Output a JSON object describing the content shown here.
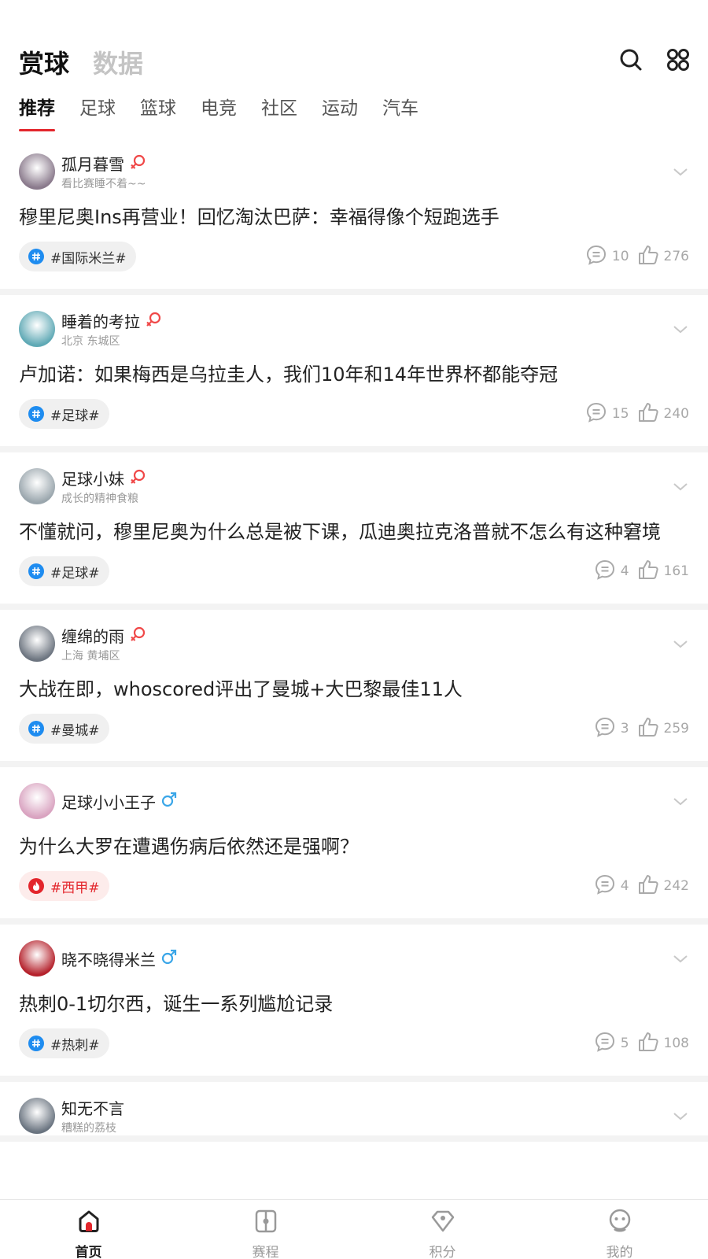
{
  "header": {
    "tab_active": "赏球",
    "tab_inactive": "数据",
    "icons": [
      "search-icon",
      "grid-menu-icon"
    ]
  },
  "sub_tabs": [
    "推荐",
    "足球",
    "篮球",
    "电竞",
    "社区",
    "运动",
    "汽车"
  ],
  "posts": [
    {
      "username": "孤月暮雪",
      "gender": "female",
      "subtitle": "看比赛睡不着~~",
      "title": "穆里尼奥Ins再营业！回忆淘汰巴萨：幸福得像个短跑选手",
      "tag": "#国际米兰#",
      "tag_kind": "topic",
      "comments": "10",
      "likes": "276",
      "avatar_color": "#8a7a8c"
    },
    {
      "username": "睡着的考拉",
      "gender": "female",
      "subtitle": "北京 东城区",
      "title": "卢加诺：如果梅西是乌拉圭人，我们10年和14年世界杯都能夺冠",
      "tag": "#足球#",
      "tag_kind": "topic",
      "comments": "15",
      "likes": "240",
      "avatar_color": "#5fa9b5"
    },
    {
      "username": "足球小妹",
      "gender": "female",
      "subtitle": "成长的精神食粮",
      "title": "不懂就问，穆里尼奥为什么总是被下课，瓜迪奥拉克洛普就不怎么有这种窘境",
      "tag": "#足球#",
      "tag_kind": "topic",
      "comments": "4",
      "likes": "161",
      "avatar_color": "#9aa6ad"
    },
    {
      "username": "缠绵的雨",
      "gender": "female",
      "subtitle": "上海 黄埔区",
      "title": "大战在即，whoscored评出了曼城+大巴黎最佳11人",
      "tag": "#曼城#",
      "tag_kind": "topic",
      "comments": "3",
      "likes": "259",
      "avatar_color": "#6d7580"
    },
    {
      "username": "足球小小王子",
      "gender": "male",
      "subtitle": "",
      "title": "为什么大罗在遭遇伤病后依然还是强啊？",
      "tag": "#西甲#",
      "tag_kind": "hot",
      "comments": "4",
      "likes": "242",
      "avatar_color": "#d9a3c0"
    },
    {
      "username": "晓不晓得米兰",
      "gender": "male",
      "subtitle": "",
      "title": "热刺0-1切尔西，诞生一系列尴尬记录",
      "tag": "#热刺#",
      "tag_kind": "topic",
      "comments": "5",
      "likes": "108",
      "avatar_color": "#b5222c"
    },
    {
      "username": "知无不言",
      "gender": "",
      "subtitle": "糟糕的荔枝",
      "title": "",
      "tag": "",
      "tag_kind": "",
      "comments": "",
      "likes": "",
      "avatar_color": "#6a7480"
    }
  ],
  "tabbar": [
    {
      "label": "首页",
      "icon": "home-icon",
      "active": true
    },
    {
      "label": "赛程",
      "icon": "schedule-icon",
      "active": false
    },
    {
      "label": "积分",
      "icon": "points-icon",
      "active": false
    },
    {
      "label": "我的",
      "icon": "profile-icon",
      "active": false
    }
  ],
  "colors": {
    "accent": "#e3262c",
    "topic_blue": "#1e8cf0",
    "female": "#f04848",
    "male": "#3aa6e8"
  }
}
